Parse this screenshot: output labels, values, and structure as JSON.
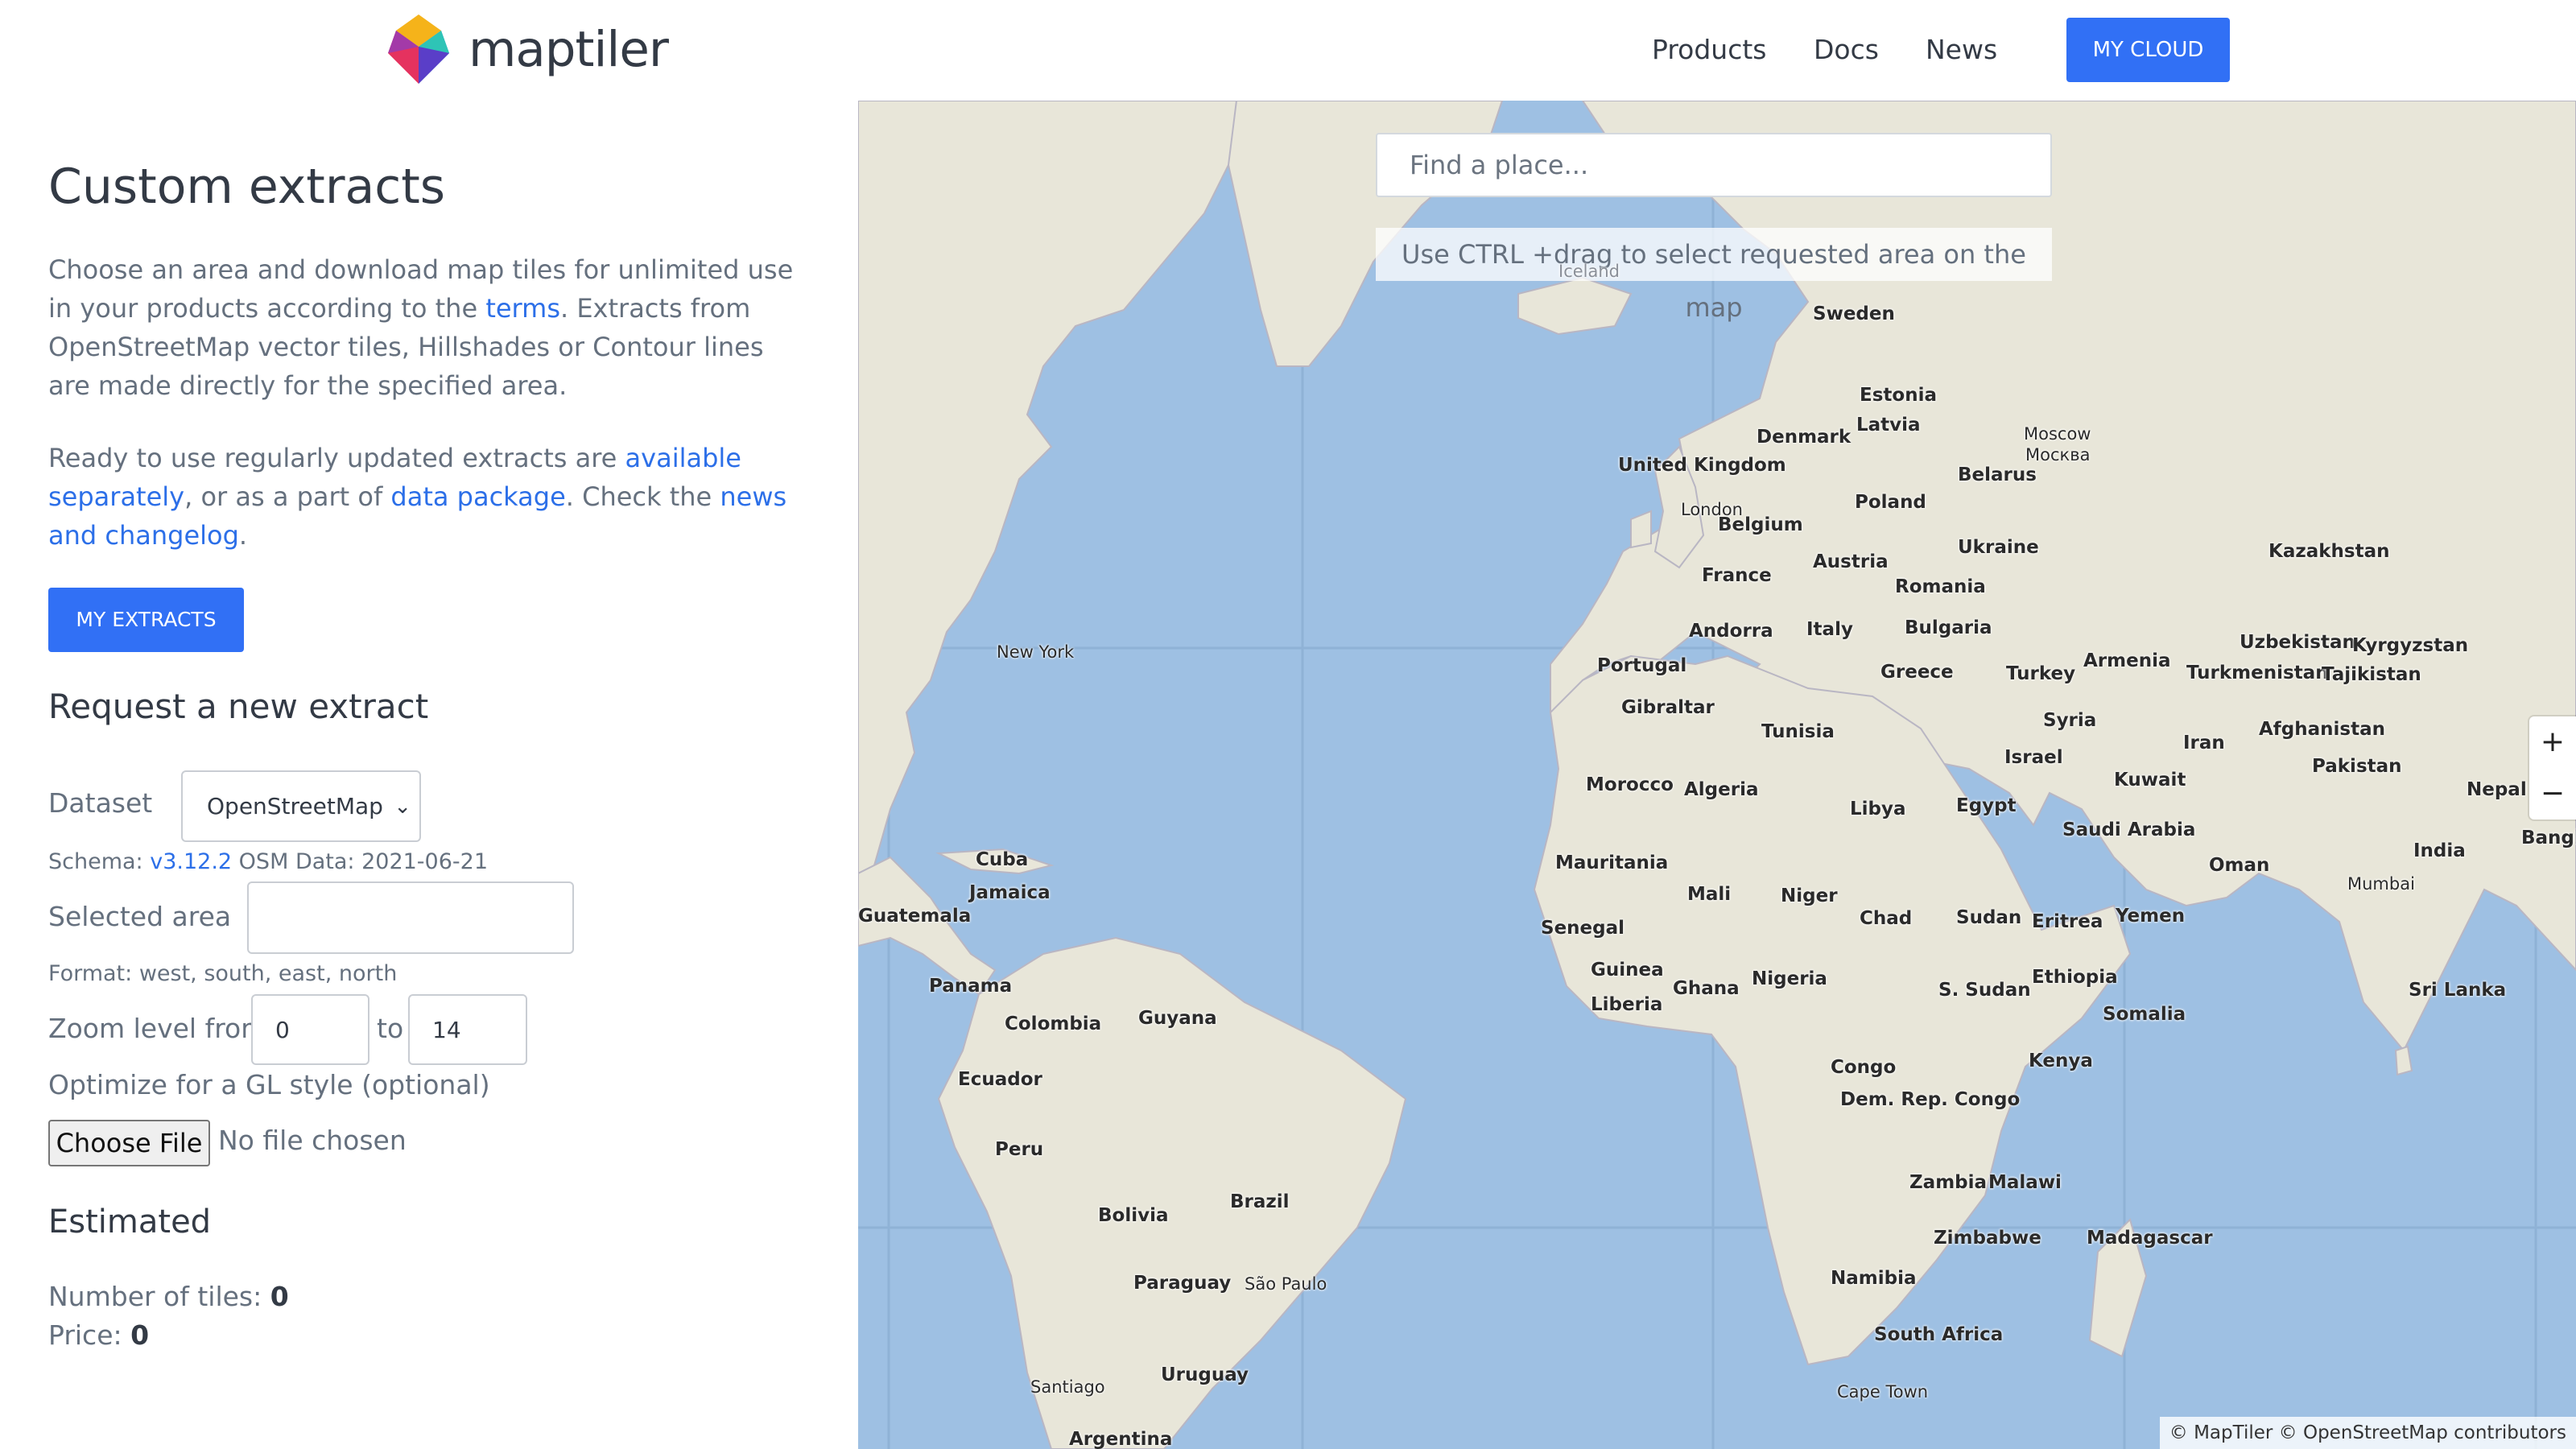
{
  "header": {
    "logo_text": "maptiler",
    "nav": [
      "Products",
      "Docs",
      "News"
    ],
    "cloud_button": "MY CLOUD"
  },
  "panel": {
    "title": "Custom extracts",
    "intro_1": "Choose an area and download map tiles for unlimited use in your products according to the ",
    "intro_terms": "terms",
    "intro_2": ". Extracts from OpenStreetMap vector tiles, Hillshades or Contour lines are made directly for the specified area.",
    "ready_1": "Ready to use regularly updated extracts are ",
    "ready_link1": "available separately",
    "ready_2": ", or as a part of ",
    "ready_link2": "data package",
    "ready_3": ". Check the ",
    "ready_link3": "news and changelog",
    "ready_4": ".",
    "extracts_button": "MY EXTRACTS",
    "request_heading": "Request a new extract",
    "dataset_label": "Dataset",
    "dataset_value": "OpenStreetMap",
    "schema_label": "Schema: ",
    "schema_version": "v3.12.2",
    "osm_data": " OSM Data: 2021-06-21",
    "area_label": "Selected area",
    "area_value": "",
    "format_hint": "Format: west, south, east, north",
    "zoom_label": "Zoom level from",
    "zoom_from": "0",
    "zoom_to_label": "to",
    "zoom_to": "14",
    "gl_label": "Optimize for a GL style (optional)",
    "file_button": "Choose File",
    "file_status": "No file chosen",
    "estimated_heading": "Estimated",
    "tiles_label": "Number of tiles: ",
    "tiles_value": "0",
    "price_label": "Price: ",
    "price_value": "0"
  },
  "map": {
    "search_placeholder": "Find a place...",
    "hint": "Use CTRL +drag to select requested area on the map",
    "zoom_in": "+",
    "zoom_out": "−",
    "attribution": "© MapTiler © OpenStreetMap contributors",
    "labels": [
      {
        "t": "Sweden",
        "c": false
      },
      {
        "t": "Estonia",
        "c": false
      },
      {
        "t": "Latvia",
        "c": false
      },
      {
        "t": "Moscow",
        "c": true
      },
      {
        "t": "Москва",
        "c": true
      },
      {
        "t": "Denmark",
        "c": false
      },
      {
        "t": "United Kingdom",
        "c": false
      },
      {
        "t": "Belarus",
        "c": false
      },
      {
        "t": "London",
        "c": true
      },
      {
        "t": "Belgium",
        "c": false
      },
      {
        "t": "Poland",
        "c": false
      },
      {
        "t": "Ukraine",
        "c": false
      },
      {
        "t": "Kazakhstan",
        "c": false
      },
      {
        "t": "Austria",
        "c": false
      },
      {
        "t": "France",
        "c": false
      },
      {
        "t": "Romania",
        "c": false
      },
      {
        "t": "Andorra",
        "c": false
      },
      {
        "t": "Italy",
        "c": false
      },
      {
        "t": "Bulgaria",
        "c": false
      },
      {
        "t": "Uzbekistan",
        "c": false
      },
      {
        "t": "Kyrgyzstan",
        "c": false
      },
      {
        "t": "New York",
        "c": true
      },
      {
        "t": "Portugal",
        "c": false
      },
      {
        "t": "Greece",
        "c": false
      },
      {
        "t": "Turkey",
        "c": false
      },
      {
        "t": "Armenia",
        "c": false
      },
      {
        "t": "Turkmenistan",
        "c": false
      },
      {
        "t": "Tajikistan",
        "c": false
      },
      {
        "t": "Gibraltar",
        "c": false
      },
      {
        "t": "Tunisia",
        "c": false
      },
      {
        "t": "Syria",
        "c": false
      },
      {
        "t": "Afghanistan",
        "c": false
      },
      {
        "t": "Iran",
        "c": false
      },
      {
        "t": "Israel",
        "c": false
      },
      {
        "t": "Pakistan",
        "c": false
      },
      {
        "t": "Kuwait",
        "c": false
      },
      {
        "t": "Nepal",
        "c": false
      },
      {
        "t": "Morocco",
        "c": false
      },
      {
        "t": "Algeria",
        "c": false
      },
      {
        "t": "Libya",
        "c": false
      },
      {
        "t": "Egypt",
        "c": false
      },
      {
        "t": "Saudi Arabia",
        "c": false
      },
      {
        "t": "India",
        "c": false
      },
      {
        "t": "Bangladesh",
        "c": false
      },
      {
        "t": "Oman",
        "c": false
      },
      {
        "t": "Mumbai",
        "c": true
      },
      {
        "t": "Cuba",
        "c": false
      },
      {
        "t": "Mauritania",
        "c": false
      },
      {
        "t": "Jamaica",
        "c": false
      },
      {
        "t": "Mali",
        "c": false
      },
      {
        "t": "Niger",
        "c": false
      },
      {
        "t": "Chad",
        "c": false
      },
      {
        "t": "Sudan",
        "c": false
      },
      {
        "t": "Eritrea",
        "c": false
      },
      {
        "t": "Yemen",
        "c": false
      },
      {
        "t": "Guatemala",
        "c": false
      },
      {
        "t": "Senegal",
        "c": false
      },
      {
        "t": "Guinea",
        "c": false
      },
      {
        "t": "Ghana",
        "c": false
      },
      {
        "t": "Nigeria",
        "c": false
      },
      {
        "t": "Ethiopia",
        "c": false
      },
      {
        "t": "Panama",
        "c": false
      },
      {
        "t": "S. Sudan",
        "c": false
      },
      {
        "t": "Liberia",
        "c": false
      },
      {
        "t": "Sri Lanka",
        "c": false
      },
      {
        "t": "Somalia",
        "c": false
      },
      {
        "t": "Guyana",
        "c": false
      },
      {
        "t": "Colombia",
        "c": false
      },
      {
        "t": "Kenya",
        "c": false
      },
      {
        "t": "Congo",
        "c": false
      },
      {
        "t": "Ecuador",
        "c": false
      },
      {
        "t": "Dem. Rep. Congo",
        "c": false
      },
      {
        "t": "Peru",
        "c": false
      },
      {
        "t": "Zambia",
        "c": false
      },
      {
        "t": "Malawi",
        "c": false
      },
      {
        "t": "Brazil",
        "c": false
      },
      {
        "t": "Bolivia",
        "c": false
      },
      {
        "t": "Zimbabwe",
        "c": false
      },
      {
        "t": "Madagascar",
        "c": false
      },
      {
        "t": "Paraguay",
        "c": false
      },
      {
        "t": "São Paulo",
        "c": true
      },
      {
        "t": "Namibia",
        "c": false
      },
      {
        "t": "South Africa",
        "c": false
      },
      {
        "t": "Uruguay",
        "c": false
      },
      {
        "t": "Santiago",
        "c": true
      },
      {
        "t": "Cape Town",
        "c": true
      },
      {
        "t": "Argentina",
        "c": false
      },
      {
        "t": "Iceland",
        "c": true
      }
    ]
  },
  "colors": {
    "accent": "#3170f5",
    "link": "#2c6fe8",
    "water": "#9ec0e3",
    "land": "#e8e6d9"
  }
}
